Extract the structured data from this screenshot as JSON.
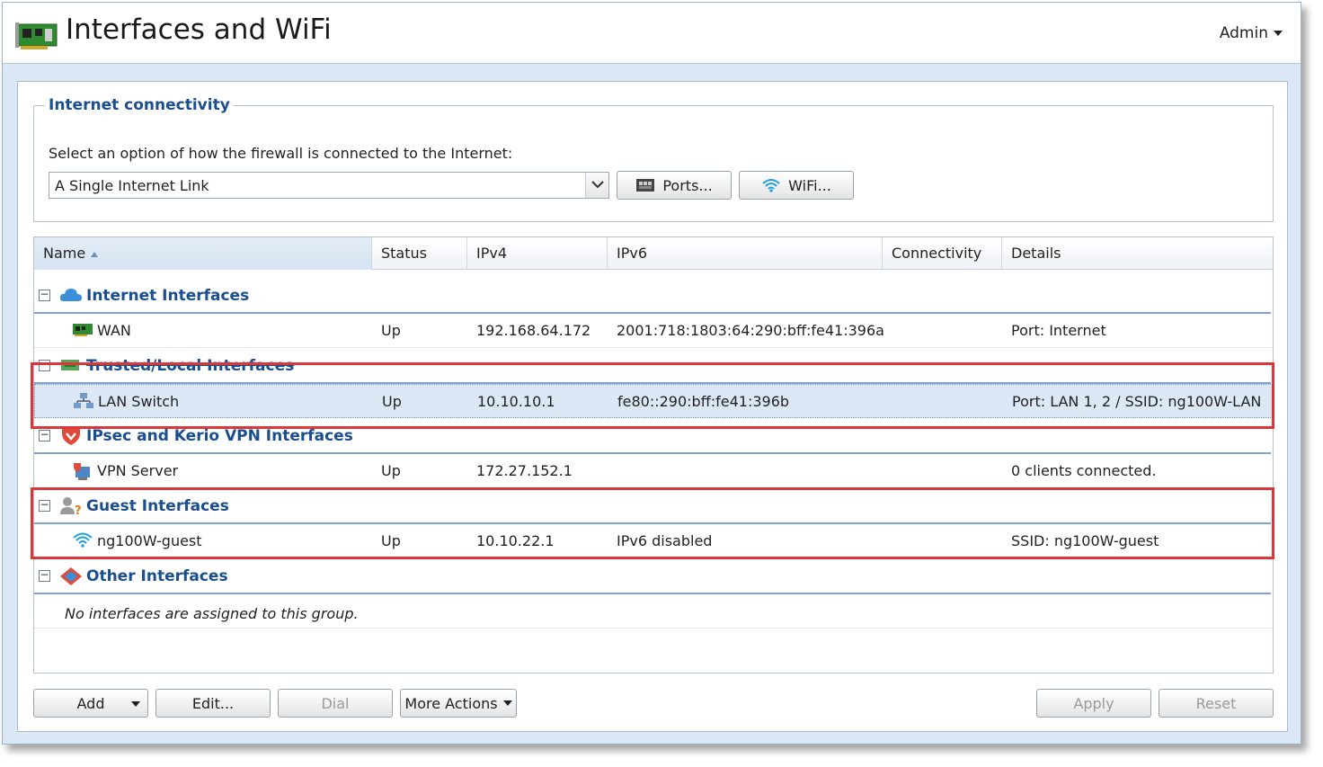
{
  "header": {
    "title": "Interfaces and WiFi",
    "user_menu": "Admin"
  },
  "connectivity": {
    "legend": "Internet connectivity",
    "prompt": "Select an option of how the firewall is connected to the Internet:",
    "mode_value": "A Single Internet Link",
    "ports_button": "Ports...",
    "wifi_button": "WiFi..."
  },
  "grid": {
    "columns": {
      "name": "Name",
      "status": "Status",
      "ipv4": "IPv4",
      "ipv6": "IPv6",
      "connectivity": "Connectivity",
      "details": "Details"
    },
    "groups": [
      {
        "name": "Internet Interfaces",
        "icon": "cloud-icon",
        "rows": [
          {
            "name": "WAN",
            "icon": "network-card-icon",
            "status": "Up",
            "ipv4": "192.168.64.172",
            "ipv6": "2001:718:1803:64:290:bff:fe41:396a",
            "connectivity": "",
            "details": "Port: Internet"
          }
        ]
      },
      {
        "name": "Trusted/Local Interfaces",
        "icon": "trusted-network-icon",
        "rows": [
          {
            "name": "LAN Switch",
            "icon": "switch-icon",
            "status": "Up",
            "ipv4": "10.10.10.1",
            "ipv6": "fe80::290:bff:fe41:396b",
            "connectivity": "",
            "details": "Port: LAN 1, 2 / SSID: ng100W-LAN"
          }
        ]
      },
      {
        "name": "IPsec and Kerio VPN Interfaces",
        "icon": "vpn-shield-icon",
        "rows": [
          {
            "name": "VPN Server",
            "icon": "vpn-server-icon",
            "status": "Up",
            "ipv4": "172.27.152.1",
            "ipv6": "",
            "connectivity": "",
            "details": "0 clients connected."
          }
        ]
      },
      {
        "name": "Guest Interfaces",
        "icon": "guest-user-icon",
        "rows": [
          {
            "name": "ng100W-guest",
            "icon": "wifi-icon",
            "status": "Up",
            "ipv4": "10.10.22.1",
            "ipv6": "IPv6 disabled",
            "connectivity": "",
            "details": "SSID: ng100W-guest"
          }
        ]
      },
      {
        "name": "Other Interfaces",
        "icon": "other-interfaces-icon",
        "empty_message": "No interfaces are assigned to this group."
      }
    ]
  },
  "footer": {
    "add": "Add",
    "edit": "Edit...",
    "dial": "Dial",
    "more_actions": "More Actions",
    "apply": "Apply",
    "reset": "Reset"
  },
  "colors": {
    "group_title": "#1a4e8f",
    "highlight": "#d9383a",
    "selected_row": "#dde8f6"
  }
}
